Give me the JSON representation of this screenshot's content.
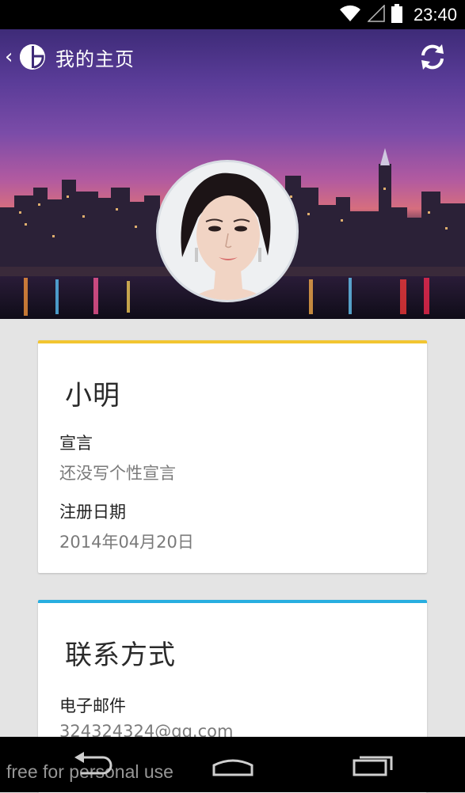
{
  "status_bar": {
    "time": "23:40"
  },
  "app_bar": {
    "back_glyph": "‹",
    "title": "我的主页"
  },
  "profile_card": {
    "accent_color": "#f2c531",
    "name": "小明",
    "motto_label": "宣言",
    "motto_value": "还没写个性宣言",
    "register_label": "注册日期",
    "register_value": "2014年04月20日"
  },
  "contact_card": {
    "accent_color": "#28aee0",
    "title": "联系方式",
    "email_label": "电子邮件",
    "email_value": "324324324@qq.com"
  },
  "watermark": "free for personal use",
  "icons": [
    "wifi-icon",
    "signal-icon",
    "battery-icon",
    "app-logo-icon",
    "refresh-icon",
    "back-nav-icon",
    "home-nav-icon",
    "recents-nav-icon"
  ]
}
